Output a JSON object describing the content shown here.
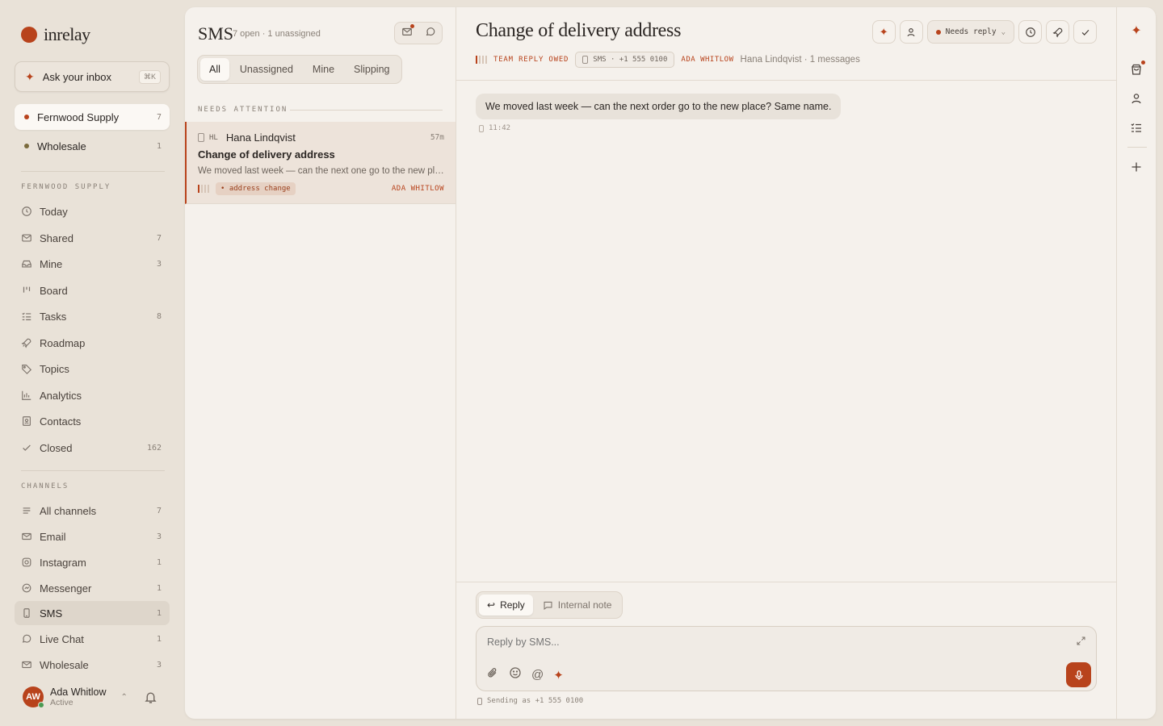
{
  "app": {
    "name": "inrelay"
  },
  "ask": {
    "label": "Ask your inbox",
    "shortcut": "⌘K"
  },
  "workspaces": [
    {
      "name": "Fernwood Supply",
      "count": "7",
      "color": "#b8431c"
    },
    {
      "name": "Wholesale",
      "count": "1",
      "color": "#7a6a3c"
    }
  ],
  "nav_section": "FERNWOOD SUPPLY",
  "nav": [
    {
      "name": "Today",
      "count": "",
      "icon": "clock-icon"
    },
    {
      "name": "Shared",
      "count": "7",
      "icon": "inbox-icon"
    },
    {
      "name": "Mine",
      "count": "3",
      "icon": "tray-icon"
    },
    {
      "name": "Board",
      "count": "",
      "icon": "board-icon"
    },
    {
      "name": "Tasks",
      "count": "8",
      "icon": "tasks-icon"
    },
    {
      "name": "Roadmap",
      "count": "",
      "icon": "rocket-icon"
    },
    {
      "name": "Topics",
      "count": "",
      "icon": "tag-icon"
    },
    {
      "name": "Analytics",
      "count": "",
      "icon": "chart-icon"
    },
    {
      "name": "Contacts",
      "count": "",
      "icon": "contact-icon"
    },
    {
      "name": "Closed",
      "count": "162",
      "icon": "check-icon"
    }
  ],
  "channels_section": "CHANNELS",
  "channels": [
    {
      "name": "All channels",
      "count": "7",
      "icon": "list-icon"
    },
    {
      "name": "Email",
      "count": "3",
      "icon": "mail-icon"
    },
    {
      "name": "Instagram",
      "count": "1",
      "icon": "instagram-icon"
    },
    {
      "name": "Messenger",
      "count": "1",
      "icon": "messenger-icon"
    },
    {
      "name": "SMS",
      "count": "1",
      "icon": "phone-icon"
    },
    {
      "name": "Live Chat",
      "count": "1",
      "icon": "chat-icon"
    },
    {
      "name": "Wholesale",
      "count": "3",
      "icon": "mail-icon"
    }
  ],
  "user": {
    "initials": "AW",
    "name": "Ada Whitlow",
    "status": "Active"
  },
  "list": {
    "title": "SMS",
    "subtitle": "7 open · 1 unassigned",
    "tabs": [
      "All",
      "Unassigned",
      "Mine",
      "Slipping"
    ],
    "active_tab": "All",
    "section": "NEEDS ATTENTION",
    "items": [
      {
        "initials": "HL",
        "name": "Hana Lindqvist",
        "time": "57m",
        "subject": "Change of delivery address",
        "preview": "We moved last week — can the next one go to the new place? Same name.",
        "tag": "• address change",
        "assignee": "ADA WHITLOW"
      }
    ]
  },
  "detail": {
    "title": "Change of delivery address",
    "owed": "TEAM REPLY OWED",
    "channel_chip": "SMS · +1 555 0100",
    "assignee": "ADA WHITLOW",
    "info": "Hana Lindqvist · 1 messages",
    "status": "Needs reply",
    "messages": [
      {
        "text": "We moved last week — can the next order go to the new place? Same name.",
        "time": "11:42"
      }
    ],
    "composer": {
      "reply_tab": "Reply",
      "note_tab": "Internal note",
      "placeholder": "Reply by SMS...",
      "sending_as": "Sending as +1 555 0100"
    }
  }
}
